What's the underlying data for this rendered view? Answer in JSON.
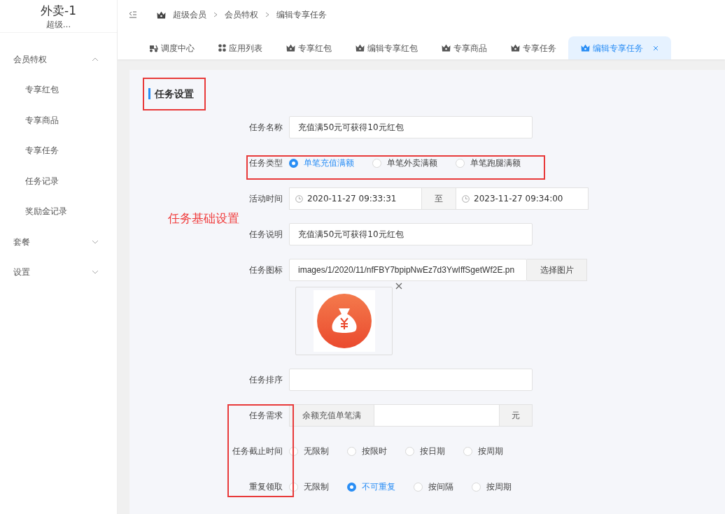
{
  "brand": {
    "title": "外卖-1",
    "subtitle": "超级…"
  },
  "sidebar": {
    "items": [
      {
        "label": "会员特权",
        "expanded": true,
        "children": [
          {
            "label": "专享红包"
          },
          {
            "label": "专享商品"
          },
          {
            "label": "专享任务"
          },
          {
            "label": "任务记录"
          },
          {
            "label": "奖励金记录"
          }
        ]
      },
      {
        "label": "套餐",
        "expanded": false
      },
      {
        "label": "设置",
        "expanded": false
      }
    ]
  },
  "breadcrumb": [
    "超级会员",
    "会员特权",
    "编辑专享任务"
  ],
  "tabs": [
    {
      "label": "调度中心",
      "kind": "dispatch",
      "selected": false
    },
    {
      "label": "应用列表",
      "kind": "apps",
      "selected": false
    },
    {
      "label": "专享红包",
      "kind": "member",
      "selected": false
    },
    {
      "label": "编辑专享红包",
      "kind": "member",
      "selected": false
    },
    {
      "label": "专享商品",
      "kind": "member",
      "selected": false
    },
    {
      "label": "专享任务",
      "kind": "member",
      "selected": false
    },
    {
      "label": "编辑专享任务",
      "kind": "member",
      "selected": true
    }
  ],
  "section_title": "任务设置",
  "annotation": "任务基础设置",
  "form": [
    {
      "kind": "text",
      "label": "任务名称",
      "value": "充值满50元可获得10元红包"
    },
    {
      "kind": "radio",
      "label": "任务类型",
      "options": [
        {
          "label": "单笔充值满额",
          "selected": true
        },
        {
          "label": "单笔外卖满额",
          "selected": false
        },
        {
          "label": "单笔跑腿满额",
          "selected": false
        }
      ]
    },
    {
      "kind": "daterange",
      "label": "活动时间",
      "start": "2020-11-27 09:33:31",
      "separator": "至",
      "end": "2023-11-27 09:34:00"
    },
    {
      "kind": "text",
      "label": "任务说明",
      "value": "充值满50元可获得10元红包"
    },
    {
      "kind": "file",
      "label": "任务图标",
      "value": "images/1/2020/11/nfFBY7bpipNwEz7d3YwIffSgetWf2E.pn",
      "button": "选择图片"
    },
    {
      "kind": "image"
    },
    {
      "kind": "text",
      "label": "任务排序"
    },
    {
      "kind": "addon",
      "label": "任务需求",
      "prefix": "余额充值单笔满",
      "suffix": "元"
    },
    {
      "kind": "radio",
      "label": "任务截止时间",
      "options": [
        {
          "label": "无限制",
          "selected": false
        },
        {
          "label": "按限时",
          "selected": false
        },
        {
          "label": "按日期",
          "selected": false
        },
        {
          "label": "按周期",
          "selected": false
        }
      ]
    },
    {
      "kind": "radio",
      "label": "重复领取",
      "options": [
        {
          "label": "无限制",
          "selected": false
        },
        {
          "label": "不可重复",
          "selected": true
        },
        {
          "label": "按间隔",
          "selected": false
        },
        {
          "label": "按周期",
          "selected": false
        }
      ]
    }
  ]
}
